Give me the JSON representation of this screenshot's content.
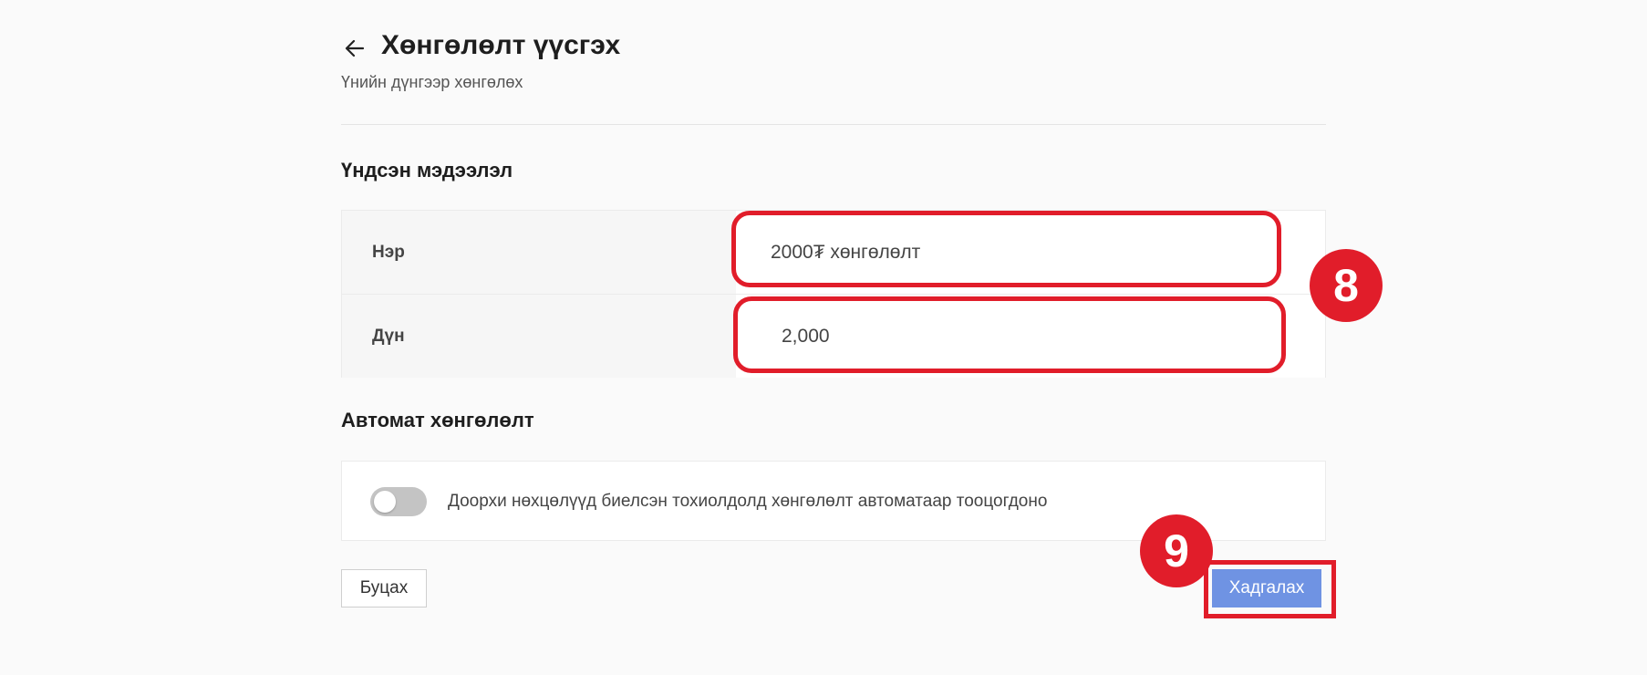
{
  "header": {
    "title": "Хөнгөлөлт үүсгэх",
    "subtitle": "Үнийн дүнгээр хөнгөлөх",
    "back_icon": "arrow-left-icon"
  },
  "basic_section": {
    "title": "Үндсэн мэдээлэл",
    "fields": [
      {
        "label": "Нэр",
        "value": "2000₮ хөнгөлөлт"
      },
      {
        "label": "Дүн",
        "value": "2,000"
      }
    ]
  },
  "auto_section": {
    "title": "Автомат хөнгөлөлт",
    "toggle_on": false,
    "description": "Доорхи нөхцөлүүд биелсэн тохиолдолд хөнгөлөлт автоматаар тооцогдоно"
  },
  "actions": {
    "cancel_label": "Буцах",
    "save_label": "Хадгалах"
  },
  "annotations": {
    "step_fields": "8",
    "step_save": "9",
    "highlight_color": "#e11d2a"
  },
  "colors": {
    "primary_button": "#6f93e3",
    "toggle_off": "#c4c4c4",
    "background": "#fafafa"
  }
}
